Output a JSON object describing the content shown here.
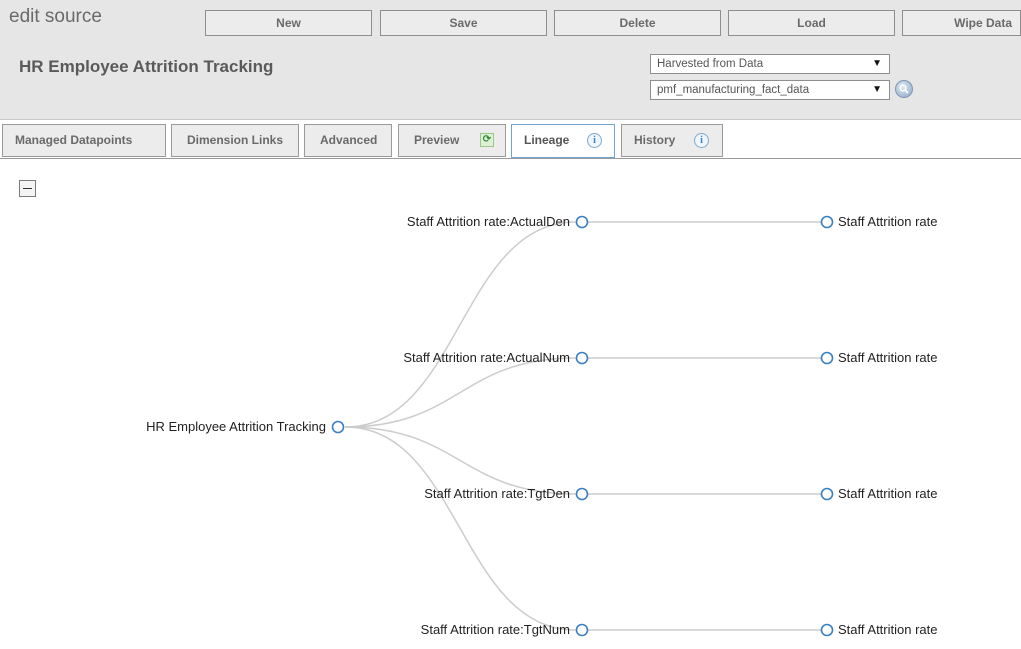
{
  "app_label": "edit source",
  "toolbar": {
    "new_label": "New",
    "save_label": "Save",
    "delete_label": "Delete",
    "load_label": "Load",
    "wipe_label": "Wipe Data"
  },
  "page_title": "HR Employee Attrition Tracking",
  "selects": {
    "source_type": "Harvested from Data",
    "table": "pmf_manufacturing_fact_data"
  },
  "tabs": [
    {
      "label": "Managed Datapoints"
    },
    {
      "label": "Dimension Links"
    },
    {
      "label": "Advanced"
    },
    {
      "label": "Preview"
    },
    {
      "label": "Lineage"
    },
    {
      "label": "History"
    }
  ],
  "active_tab": "Lineage",
  "lineage": {
    "root": {
      "label": "HR Employee Attrition Tracking"
    },
    "middle": [
      {
        "label": "Staff Attrition rate:ActualDen"
      },
      {
        "label": "Staff Attrition rate:ActualNum"
      },
      {
        "label": "Staff Attrition rate:TgtDen"
      },
      {
        "label": "Staff Attrition rate:TgtNum"
      }
    ],
    "leaves": [
      {
        "label": "Staff Attrition rate"
      },
      {
        "label": "Staff Attrition rate"
      },
      {
        "label": "Staff Attrition rate"
      },
      {
        "label": "Staff Attrition rate"
      }
    ]
  },
  "colors": {
    "node_stroke": "#3a7fc1",
    "link": "#cccccc",
    "active_tab_border": "#6fa6d6"
  }
}
